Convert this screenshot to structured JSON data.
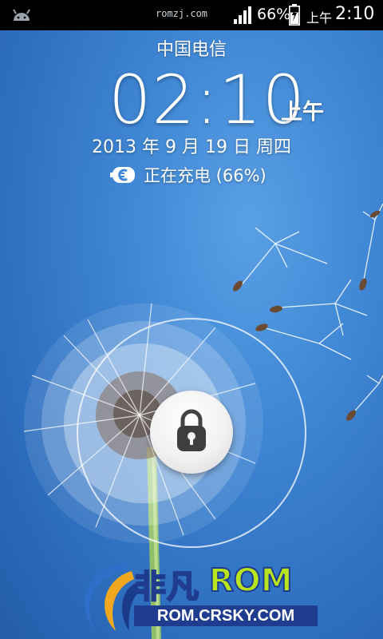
{
  "statusbar": {
    "watermark": "romzj.com",
    "battery_percent": "66%",
    "ampm": "上午",
    "time": "2:10",
    "signal_level": 1.0,
    "battery_level": 0.66
  },
  "lockscreen": {
    "carrier": "中国电信",
    "clock": "02:10",
    "clock_ampm": "上午",
    "date": "2013 年 9 月 19 日 周四",
    "charging_status": "正在充电 (66%)"
  },
  "watermark_logo": {
    "brand_cn": "非凡",
    "brand_rom": "ROM",
    "url": "ROM.CRSKY.COM"
  },
  "colors": {
    "statusbar_bg": "#000000",
    "sky": "#3f86d4",
    "logo_blue": "#1f3c8f",
    "logo_green": "#b9e41c"
  },
  "icons": {
    "statusbar_left": "android-icon",
    "signal": "signal-bars-icon",
    "battery": "battery-charging-icon",
    "charge": "charging-plug-icon",
    "unlock": "padlock-icon"
  }
}
